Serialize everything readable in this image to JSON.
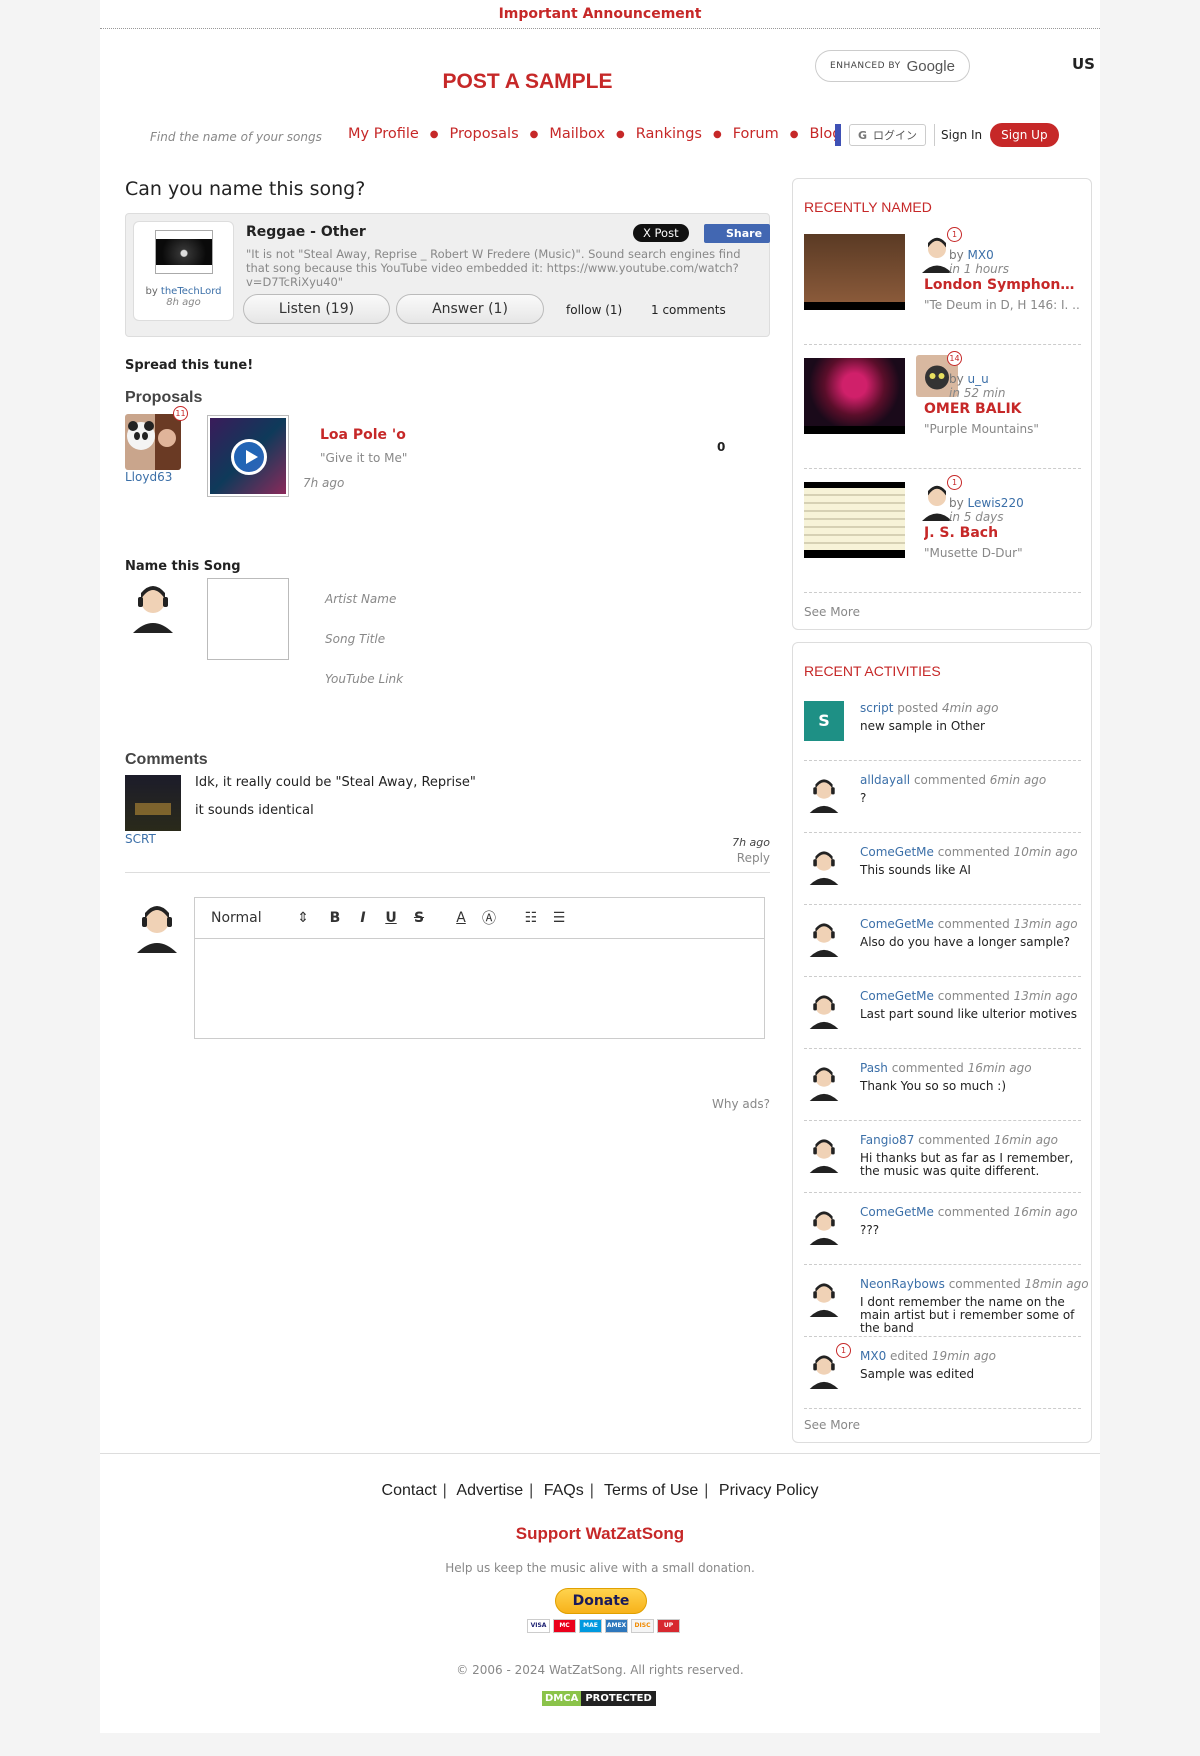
{
  "announcement": "Important Announcement",
  "header": {
    "brand": "POST A SAMPLE",
    "google_enhanced": "ENHANCED BY",
    "google_word": "Google",
    "lang": "US",
    "find_hint": "Find the name of your songs",
    "nav": [
      "My Profile",
      "Proposals",
      "Mailbox",
      "Rankings",
      "Forum",
      "Blog"
    ],
    "google_login": "ログイン",
    "sign_in": "Sign In",
    "sign_up": "Sign Up"
  },
  "sample": {
    "question": "Can you name this song?",
    "uploader_by": "by",
    "uploader": "theTechLord",
    "uploaded_ago": "8h ago",
    "genre": "Reggae - Other",
    "description": "\"It is not \"Steal Away, Reprise _ Robert W Fredere (Music)\". Sound search engines find that song because this YouTube video embedded it: https://www.youtube.com/watch?v=D7TcRiXyu40\"",
    "x_post": "X Post",
    "share": "Share",
    "listen": "Listen (19)",
    "answer": "Answer (1)",
    "follow": "follow (1)",
    "comments_count": "1 comments"
  },
  "spread": "Spread this tune!",
  "proposals": {
    "title": "Proposals",
    "items": [
      {
        "user": "Lloyd63",
        "badge": "11",
        "artist": "Loa Pole 'o",
        "song": "\"Give it to Me\"",
        "ago": "7h ago",
        "votes": "0"
      }
    ]
  },
  "name_song": {
    "title": "Name this Song",
    "artist_placeholder": "Artist Name",
    "title_placeholder": "Song Title",
    "youtube_placeholder": "YouTube Link"
  },
  "comments": {
    "title": "Comments",
    "items": [
      {
        "user": "SCRT",
        "line1": "Idk, it really could be \"Steal Away, Reprise\"",
        "line2": "it sounds identical",
        "ago": "7h ago",
        "reply": "Reply"
      }
    ]
  },
  "editor": {
    "format": "Normal"
  },
  "why_ads": "Why ads?",
  "recently_named": {
    "title": "RECENTLY NAMED",
    "items": [
      {
        "by": "MX0",
        "badge": "1",
        "in": "1 hours",
        "artist": "London Symphony ...",
        "song": "\"Te Deum in D, H 146: I. ..."
      },
      {
        "by": "u_u",
        "badge": "14",
        "in": "52 min",
        "artist": "OMER BALIK",
        "song": "\"Purple Mountains\""
      },
      {
        "by": "Lewis220",
        "badge": "1",
        "in": "5 days",
        "artist": "J. S. Bach",
        "song": "\"Musette D-Dur\""
      }
    ],
    "see_more": "See More"
  },
  "recent_activities": {
    "title": "RECENT ACTIVITIES",
    "items": [
      {
        "user": "script",
        "action": "posted",
        "time": "4min ago",
        "text": "new sample in Other"
      },
      {
        "user": "alldayall",
        "action": "commented",
        "time": "6min ago",
        "text": "?"
      },
      {
        "user": "ComeGetMe",
        "action": "commented",
        "time": "10min ago",
        "text": "This sounds like AI"
      },
      {
        "user": "ComeGetMe",
        "action": "commented",
        "time": "13min ago",
        "text": "Also do you have a longer sample?"
      },
      {
        "user": "ComeGetMe",
        "action": "commented",
        "time": "13min ago",
        "text": "Last part sound like ulterior motives"
      },
      {
        "user": "Pash",
        "action": "commented",
        "time": "16min ago",
        "text": "Thank You so so much :)"
      },
      {
        "user": "Fangio87",
        "action": "commented",
        "time": "16min ago",
        "text": "Hi thanks but as far as I remember, the music was quite different."
      },
      {
        "user": "ComeGetMe",
        "action": "commented",
        "time": "16min ago",
        "text": "???"
      },
      {
        "user": "NeonRaybows",
        "action": "commented",
        "time": "18min ago",
        "text": "I dont remember the name on the main artist but i remember some of the band"
      },
      {
        "user": "MX0",
        "action": "edited",
        "time": "19min ago",
        "text": "Sample was edited",
        "badge": "1"
      }
    ],
    "script_initial": "S",
    "see_more": "See More"
  },
  "footer": {
    "links": [
      "Contact",
      "Advertise",
      "FAQs",
      "Terms of Use",
      "Privacy Policy"
    ],
    "support_title": "Support WatZatSong",
    "support_text": "Help us keep the music alive with a small donation.",
    "donate": "Donate",
    "cards": [
      "VISA",
      "MC",
      "MAE",
      "AMEX",
      "DISC",
      "UP"
    ],
    "copyright": "© 2006 - 2024 WatZatSong. All rights reserved.",
    "dmca_a": "DMCA",
    "dmca_b": "PROTECTED"
  },
  "colors": {
    "accent": "#c62828",
    "link": "#3b6fa8",
    "muted": "#888888"
  }
}
